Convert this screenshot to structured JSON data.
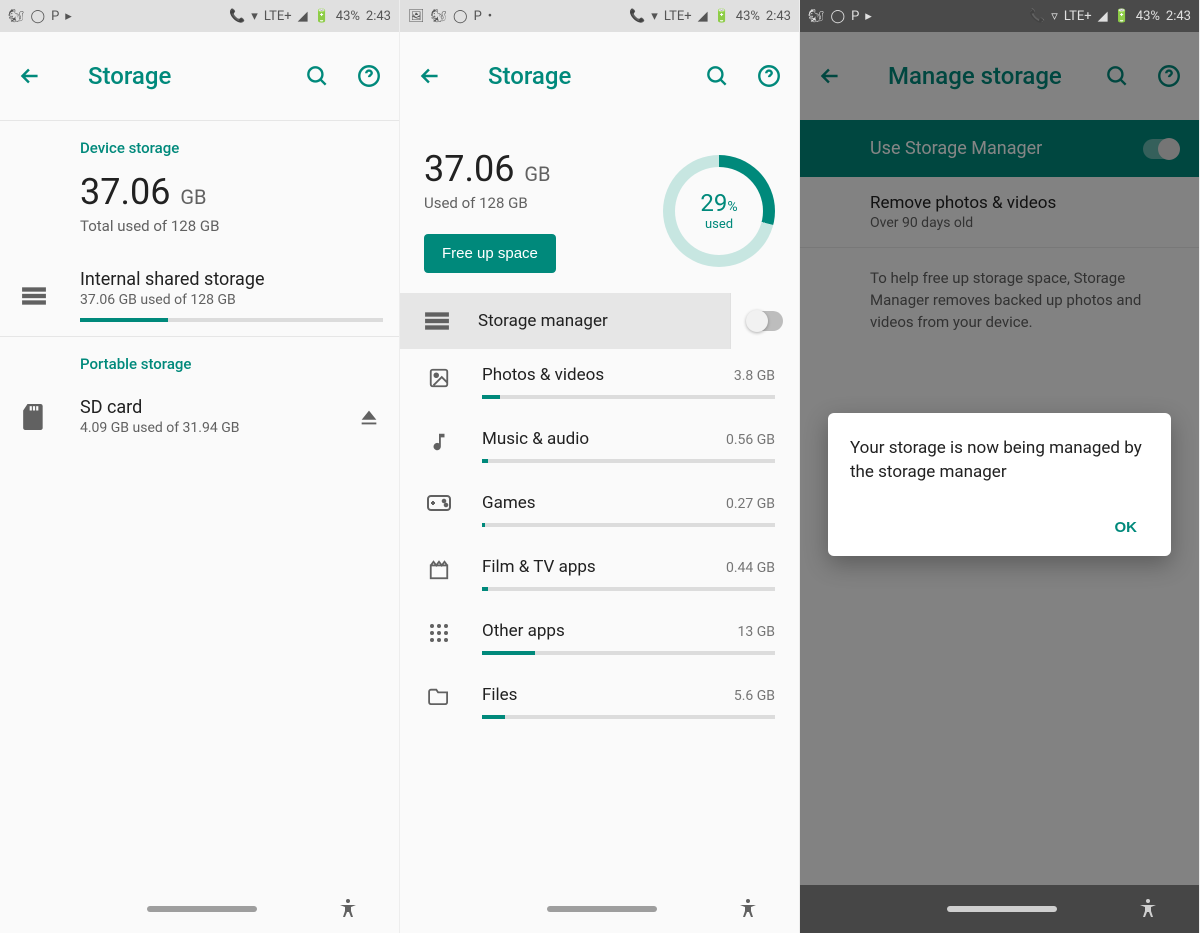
{
  "status": {
    "battery": "43%",
    "time": "2:43",
    "lte": "LTE+"
  },
  "screen1": {
    "title": "Storage",
    "device_section": "Device storage",
    "used_value": "37.06",
    "used_unit": "GB",
    "used_sub": "Total used of 128 GB",
    "internal": {
      "title": "Internal shared storage",
      "sub": "37.06 GB used of 128 GB",
      "pct": 29
    },
    "portable_section": "Portable storage",
    "sd": {
      "title": "SD card",
      "sub": "4.09 GB used of 31.94 GB"
    }
  },
  "screen2": {
    "title": "Storage",
    "used_value": "37.06",
    "used_unit": "GB",
    "used_sub": "Used of 128 GB",
    "pct_value": "29",
    "pct_sym": "%",
    "pct_label": "used",
    "free_up": "Free up space",
    "sm_label": "Storage manager",
    "categories": [
      {
        "icon": "image",
        "name": "Photos & videos",
        "size": "3.8 GB",
        "pct": 6
      },
      {
        "icon": "music",
        "name": "Music & audio",
        "size": "0.56 GB",
        "pct": 2
      },
      {
        "icon": "game",
        "name": "Games",
        "size": "0.27 GB",
        "pct": 1
      },
      {
        "icon": "film",
        "name": "Film & TV apps",
        "size": "0.44 GB",
        "pct": 2
      },
      {
        "icon": "apps",
        "name": "Other apps",
        "size": "13 GB",
        "pct": 18
      },
      {
        "icon": "folder",
        "name": "Files",
        "size": "5.6 GB",
        "pct": 8
      }
    ]
  },
  "screen3": {
    "title": "Manage storage",
    "switch_label": "Use Storage Manager",
    "remove": {
      "title": "Remove photos & videos",
      "sub": "Over 90 days old"
    },
    "help": "To help free up storage space, Storage Manager removes backed up photos and videos from your device.",
    "dialog_msg": "Your storage is now being managed by the storage manager",
    "dialog_ok": "OK"
  }
}
